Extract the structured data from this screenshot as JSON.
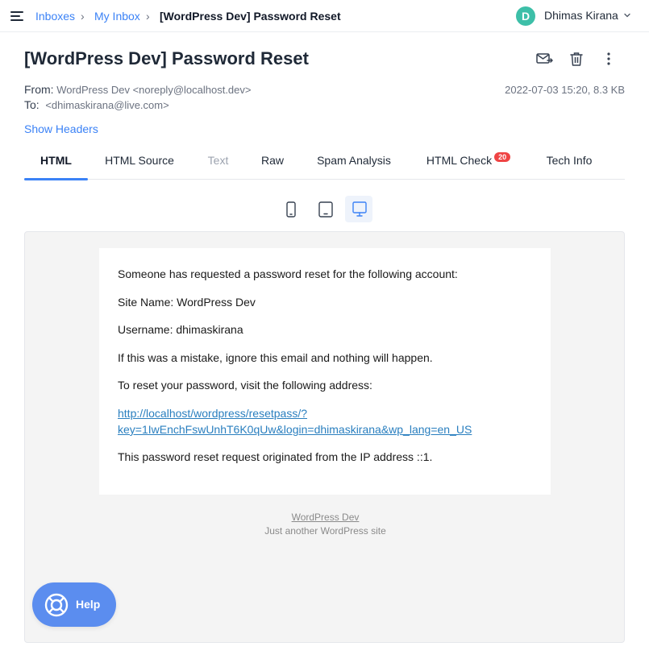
{
  "breadcrumb": {
    "items": [
      "Inboxes",
      "My Inbox"
    ],
    "separator": "›",
    "current": "[WordPress Dev] Password Reset"
  },
  "user": {
    "initial": "D",
    "name": "Dhimas Kirana"
  },
  "message": {
    "subject": "[WordPress Dev] Password Reset",
    "from_label": "From:",
    "from_value": "WordPress Dev <noreply@localhost.dev>",
    "to_label": "To:",
    "to_value": "<dhimaskirana@live.com>",
    "date_size": "2022-07-03 15:20, 8.3 KB",
    "show_headers": "Show Headers"
  },
  "tabs": [
    {
      "label": "HTML",
      "active": true
    },
    {
      "label": "HTML Source"
    },
    {
      "label": "Text",
      "disabled": true
    },
    {
      "label": "Raw"
    },
    {
      "label": "Spam Analysis"
    },
    {
      "label": "HTML Check",
      "badge": "20"
    },
    {
      "label": "Tech Info"
    }
  ],
  "email": {
    "lines": [
      "Someone has requested a password reset for the following account:",
      "Site Name: WordPress Dev",
      "Username: dhimaskirana",
      "If this was a mistake, ignore this email and nothing will happen.",
      "To reset your password, visit the following address:"
    ],
    "link_line1": "http://localhost/wordpress/resetpass/?",
    "link_line2": "key=1IwEnchFswUnhT6K0qUw&login=dhimaskirana&wp_lang=en_US",
    "ip_line": "This password reset request originated from the IP address ::1.",
    "footer_site": "WordPress Dev",
    "footer_tagline": "Just another WordPress site"
  },
  "help": {
    "label": "Help"
  },
  "colors": {
    "accent": "#3b82f6",
    "avatar": "#3dbfa8",
    "badge": "#ef4444",
    "help": "#5b8def",
    "link": "#2a7fbf"
  },
  "icons": [
    "menu-icon",
    "chevron-right-icon",
    "chevron-down-icon",
    "mail-forward-icon",
    "trash-icon",
    "more-vertical-icon",
    "phone-icon",
    "tablet-icon",
    "monitor-icon",
    "lifebuoy-icon"
  ]
}
